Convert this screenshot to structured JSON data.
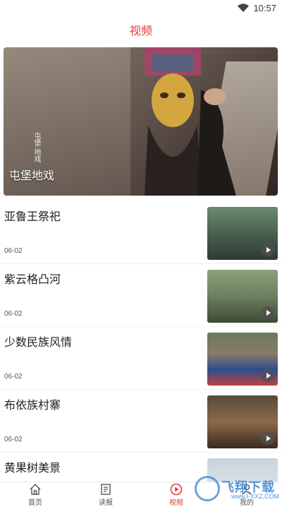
{
  "status_bar": {
    "time": "10:57"
  },
  "header": {
    "title": "视频"
  },
  "hero": {
    "label": "屯堡地戏",
    "vertical_caption": "屯堡·地戏"
  },
  "items": [
    {
      "title": "亚鲁王祭祀",
      "date": "06-02"
    },
    {
      "title": "紫云格凸河",
      "date": "06-02"
    },
    {
      "title": "少数民族风情",
      "date": "06-02"
    },
    {
      "title": "布依族村寨",
      "date": "06-02"
    },
    {
      "title": "黄果树美景",
      "date": ""
    }
  ],
  "tabbar": {
    "tabs": [
      {
        "label": "首页",
        "icon": "home-icon"
      },
      {
        "label": "读报",
        "icon": "newspaper-icon"
      },
      {
        "label": "视频",
        "icon": "video-play-icon",
        "active": true
      },
      {
        "label": "我的",
        "icon": "user-icon"
      }
    ]
  },
  "watermark": {
    "text": "飞翔下载",
    "sub": "www.FXXZ.COM"
  },
  "colors": {
    "accent": "#e53935"
  }
}
